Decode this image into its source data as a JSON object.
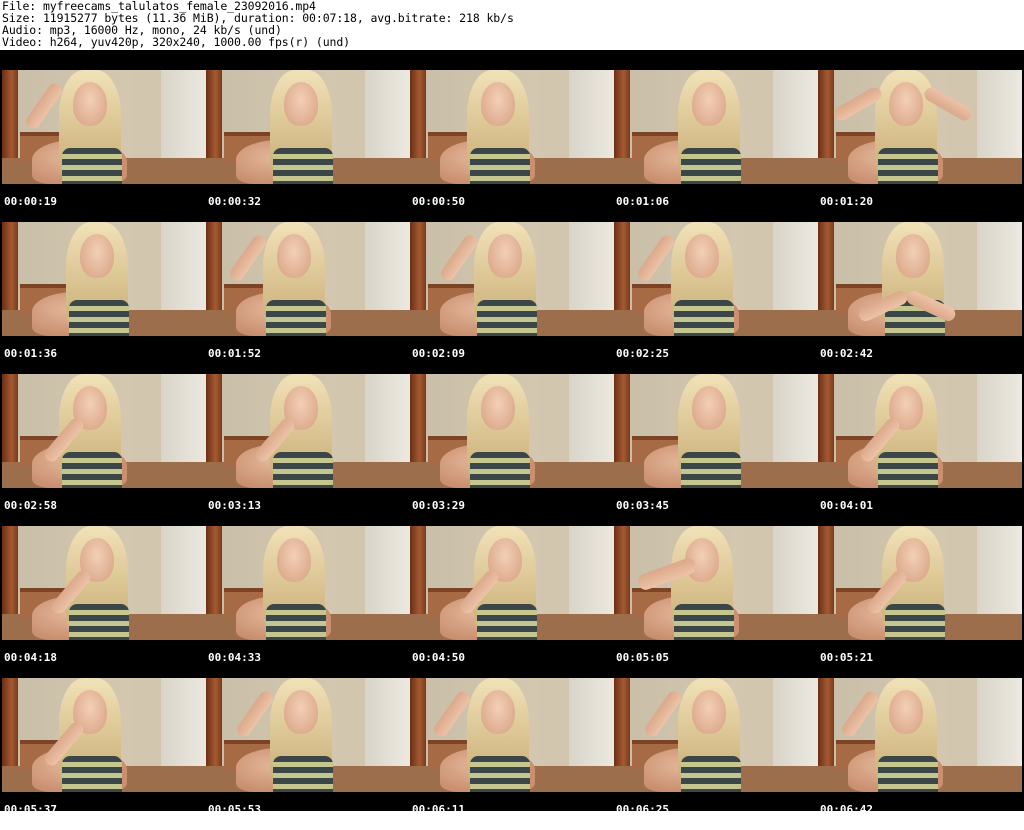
{
  "header": {
    "file": "File: myfreecams_talulatos_female_23092016.mp4",
    "size": "Size: 11915277 bytes (11.36 MiB), duration: 00:07:18, avg.bitrate: 218 kb/s",
    "audio": "Audio: mp3, 16000 Hz, mono, 24 kb/s (und)",
    "video": "Video: h264, yuv420p, 320x240, 1000.00 fps(r) (und)"
  },
  "thumbnails": [
    {
      "time": "00:00:19",
      "pose": "hand-head-left"
    },
    {
      "time": "00:00:32",
      "pose": "down"
    },
    {
      "time": "00:00:50",
      "pose": "center"
    },
    {
      "time": "00:01:06",
      "pose": "center"
    },
    {
      "time": "00:01:20",
      "pose": "arms-up"
    },
    {
      "time": "00:01:36",
      "pose": "center"
    },
    {
      "time": "00:01:52",
      "pose": "hand-head-left"
    },
    {
      "time": "00:02:09",
      "pose": "hand-head-left"
    },
    {
      "time": "00:02:25",
      "pose": "hand-head-left"
    },
    {
      "time": "00:02:42",
      "pose": "arms-crossed"
    },
    {
      "time": "00:02:58",
      "pose": "hand-chin"
    },
    {
      "time": "00:03:13",
      "pose": "hand-chin"
    },
    {
      "time": "00:03:29",
      "pose": "center"
    },
    {
      "time": "00:03:45",
      "pose": "center"
    },
    {
      "time": "00:04:01",
      "pose": "hand-chin"
    },
    {
      "time": "00:04:18",
      "pose": "hand-chin"
    },
    {
      "time": "00:04:33",
      "pose": "center"
    },
    {
      "time": "00:04:50",
      "pose": "hand-chin"
    },
    {
      "time": "00:05:05",
      "pose": "hand-face"
    },
    {
      "time": "00:05:21",
      "pose": "hand-chin"
    },
    {
      "time": "00:05:37",
      "pose": "hand-chin"
    },
    {
      "time": "00:05:53",
      "pose": "hand-head-left"
    },
    {
      "time": "00:06:11",
      "pose": "hand-head-left"
    },
    {
      "time": "00:06:25",
      "pose": "hand-head-left"
    },
    {
      "time": "00:06:42",
      "pose": "hand-head-left"
    }
  ]
}
